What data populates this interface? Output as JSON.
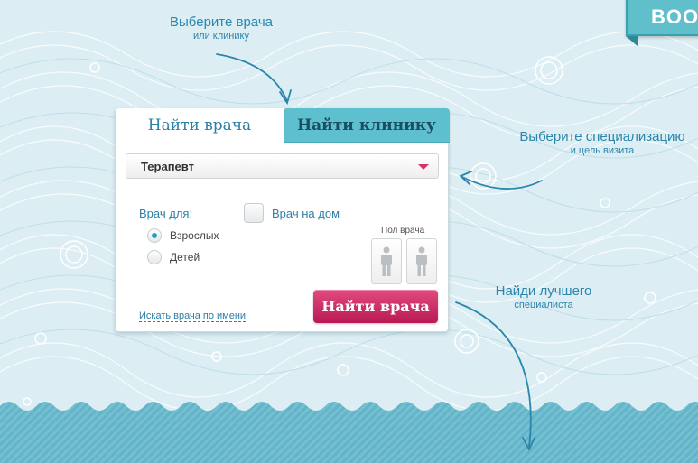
{
  "brand": {
    "ribbon_text": "BOOK"
  },
  "callouts": {
    "doctor_or_clinic": {
      "title": "Выберите врача",
      "subtitle": "или клинику"
    },
    "specialization": {
      "title": "Выберите специализацию",
      "subtitle": "и цель визита"
    },
    "best_specialist": {
      "title": "Найди лучшего",
      "subtitle": "специалиста"
    }
  },
  "search": {
    "tabs": [
      {
        "label": "Найти врача",
        "active": true
      },
      {
        "label": "Найти клинику",
        "active": false
      }
    ],
    "specialty_select": {
      "selected": "Терапевт"
    },
    "doctor_for": {
      "label": "Врач для:",
      "options": [
        {
          "label": "Взрослых",
          "checked": true
        },
        {
          "label": "Детей",
          "checked": false
        }
      ]
    },
    "home_visit": {
      "label": "Врач на дом",
      "checked": false
    },
    "gender": {
      "label": "Пол врача",
      "options": [
        "male-icon",
        "female-icon"
      ]
    },
    "name_search_link": "Искать врача по имени",
    "submit_label": "Найти врача"
  },
  "colors": {
    "accent": "#2c7fa5",
    "tab_inactive": "#5ebfce",
    "button": "#c9275f",
    "caret": "#d6336c",
    "background": "#dceef3",
    "sea": "#6cbcd0"
  }
}
